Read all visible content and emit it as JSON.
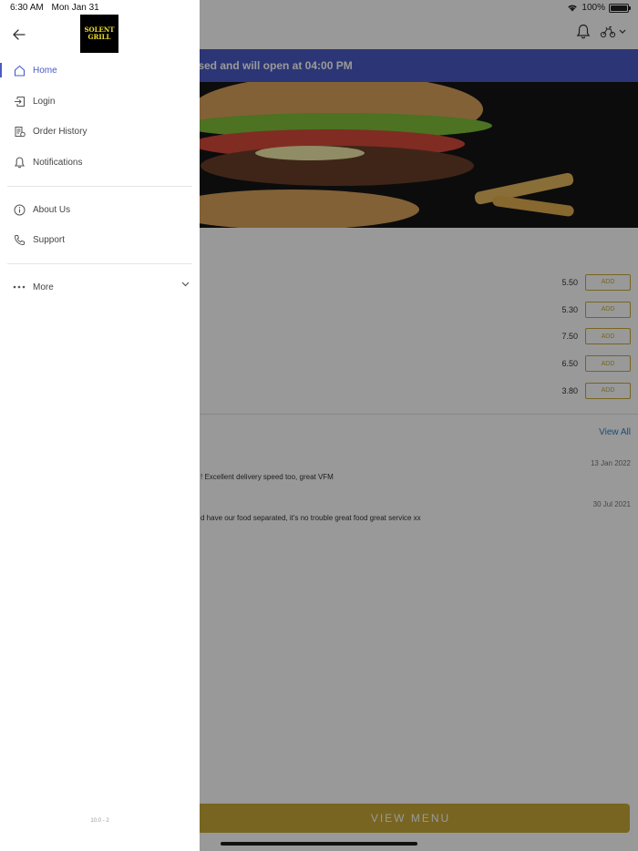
{
  "status_bar": {
    "time": "6:30 AM",
    "date": "Mon Jan 31",
    "battery": "100%"
  },
  "brand": {
    "logo_text_line1": "SOLENT",
    "logo_text_line2": "GRILL"
  },
  "drawer": {
    "nav": [
      {
        "label": "Home",
        "icon": "home-icon",
        "active": true
      },
      {
        "label": "Login",
        "icon": "login-icon",
        "active": false
      },
      {
        "label": "Order History",
        "icon": "receipt-icon",
        "active": false
      },
      {
        "label": "Notifications",
        "icon": "bell-icon",
        "active": false
      }
    ],
    "nav_secondary": [
      {
        "label": "About Us",
        "icon": "info-icon"
      },
      {
        "label": "Support",
        "icon": "phone-icon"
      }
    ],
    "more_label": "More",
    "version": "10.0 - 2"
  },
  "main": {
    "banner_text": "osed and will open at 04:00 PM",
    "menu_items": [
      {
        "price": "5.50",
        "add_label": "ADD"
      },
      {
        "price": "5.30",
        "add_label": "ADD"
      },
      {
        "price": "7.50",
        "add_label": "ADD"
      },
      {
        "price": "6.50",
        "add_label": "ADD"
      },
      {
        "price": "3.80",
        "add_label": "ADD"
      }
    ],
    "reviews": {
      "view_all_label": "View All",
      "items": [
        {
          "date": "13 Jan 2022",
          "text": "! Excellent delivery speed too, great VFM"
        },
        {
          "date": "30 Jul 2021",
          "text": "d have our food separated, it's no trouble great food great service xx"
        }
      ]
    },
    "view_menu_label": "VIEW MENU"
  },
  "colors": {
    "accent": "#4a5bc5",
    "gold": "#c8a837",
    "link": "#2f7fc1"
  }
}
